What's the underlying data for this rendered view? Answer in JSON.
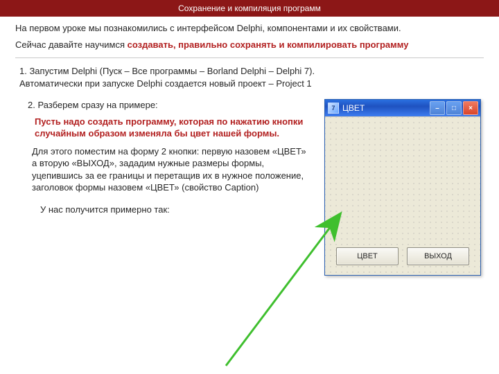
{
  "header": {
    "title": "Сохранение и компиляция программ"
  },
  "intro": "  На первом уроке мы познакомились с интерфейсом Delphi, компонентами и их свойствами.",
  "call": {
    "plain": "Сейчас давайте научимся ",
    "em": "создавать,  правильно сохранять и компилировать программу"
  },
  "step1": {
    "line1": "1. Запустим Delphi (Пуск – Все программы – Borland Delphi – Delphi 7).",
    "line2": "    Автоматически при запуске Delphi создается новый проект – Project 1"
  },
  "step2": {
    "lead": "2. Разберем сразу на примере:",
    "task": "Пусть надо создать программу, которая по нажатию кнопки случайным образом изменяла бы цвет нашей формы.",
    "body": "Для этого поместим на форму 2 кнопки: первую назовем «ЦВЕТ» а вторую «ВЫХОД», зададим нужные размеры формы, уцепившись за ее границы и перетащив их в нужное положение, заголовок формы назовем «ЦВЕТ» (свойство Caption)",
    "result": "У нас получится примерно так:"
  },
  "window": {
    "icon_glyph": "7",
    "title": "ЦВЕТ",
    "buttons": {
      "min": "–",
      "max": "□",
      "close": "×"
    },
    "form_buttons": {
      "color": "ЦВЕТ",
      "exit": "ВЫХОД"
    }
  }
}
